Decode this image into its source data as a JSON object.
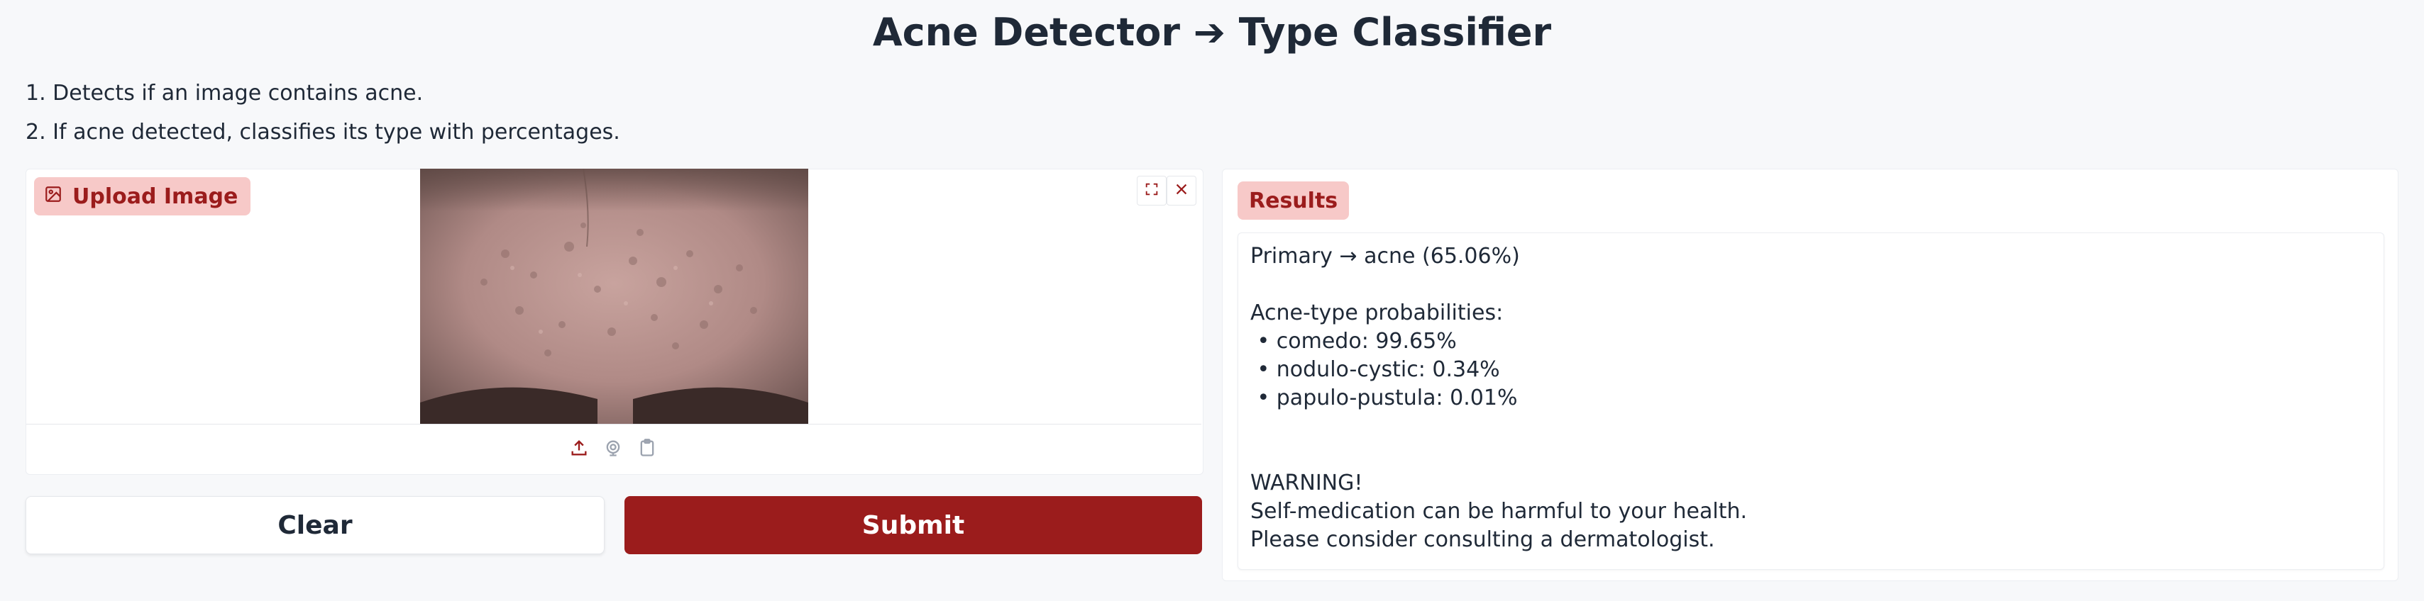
{
  "app": {
    "title": "Acne Detector ➔ Type Classifier",
    "description": [
      "1. Detects if an image contains acne.",
      "2. If acne detected, classifies its type with percentages."
    ]
  },
  "input": {
    "label": "Upload Image",
    "icons": {
      "label": "image-icon",
      "fullscreen": "fullscreen-icon",
      "close": "close-icon",
      "upload": "upload-icon",
      "webcam": "webcam-icon",
      "clipboard": "clipboard-icon"
    }
  },
  "buttons": {
    "clear": "Clear",
    "submit": "Submit"
  },
  "output": {
    "label": "Results",
    "lines": [
      "Primary → acne (65.06%)",
      "Acne-type probabilities:",
      " • comedo: 99.65%",
      " • nodulo-cystic: 0.34%",
      " • papulo-pustula: 0.01%",
      "WARNING!",
      "Self-medication can be harmful to your health.",
      "Please consider consulting a dermatologist."
    ]
  },
  "colors": {
    "accent": "#9b1c1c",
    "badge_bg": "#f7c9c8",
    "background": "#f7f8fa"
  }
}
